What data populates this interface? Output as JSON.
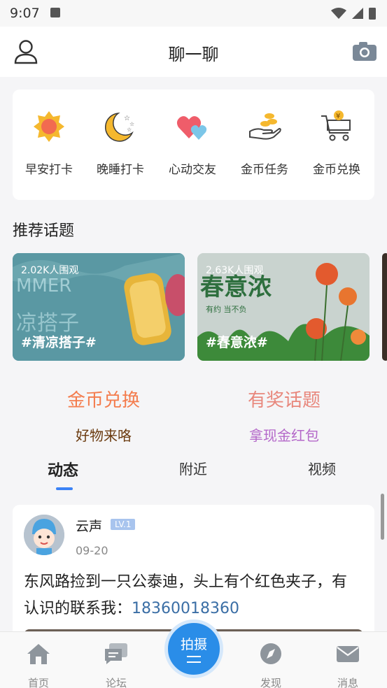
{
  "status_bar": {
    "time": "9:07"
  },
  "header": {
    "title": "聊一聊"
  },
  "quick_actions": [
    {
      "label": "早安打卡",
      "icon": "sun-icon"
    },
    {
      "label": "晚睡打卡",
      "icon": "moon-stars-icon"
    },
    {
      "label": "心动交友",
      "icon": "hearts-icon"
    },
    {
      "label": "金币任务",
      "icon": "coin-hand-icon"
    },
    {
      "label": "金币兑换",
      "icon": "shopping-cart-icon"
    }
  ],
  "recommended": {
    "title": "推荐话题",
    "topics": [
      {
        "views": "2.02K人围观",
        "name": "#清凉搭子#"
      },
      {
        "views": "2.63K人围观",
        "name": "#春意浓#"
      }
    ]
  },
  "promos": [
    {
      "title": "金币兑换",
      "subtitle": "好物来咯",
      "title_color": "#f47c4d",
      "subtitle_color": "#6b3b10"
    },
    {
      "title": "有奖话题",
      "subtitle": "拿现金红包",
      "title_color": "#e8877c",
      "subtitle_color": "#b468c9"
    }
  ],
  "feed_tabs": [
    {
      "label": "动态",
      "active": true
    },
    {
      "label": "附近",
      "active": false
    },
    {
      "label": "视频",
      "active": false
    }
  ],
  "post": {
    "author": "云声",
    "level": "LV.1",
    "date": "09-20",
    "text": "东风路捡到一只公泰迪，头上有个红色夹子，有认识的联系我：",
    "phone": "18360018360"
  },
  "bottom_nav": [
    {
      "label": "首页",
      "icon": "home-icon"
    },
    {
      "label": "论坛",
      "icon": "forum-icon"
    },
    {
      "label": "拍摄",
      "icon": "capture-icon"
    },
    {
      "label": "发现",
      "icon": "compass-icon"
    },
    {
      "label": "消息",
      "icon": "mail-icon"
    }
  ],
  "colors": {
    "accent": "#2a8de8",
    "tab_indicator": "#3b82f6",
    "level_badge": "#a8c4ee"
  }
}
